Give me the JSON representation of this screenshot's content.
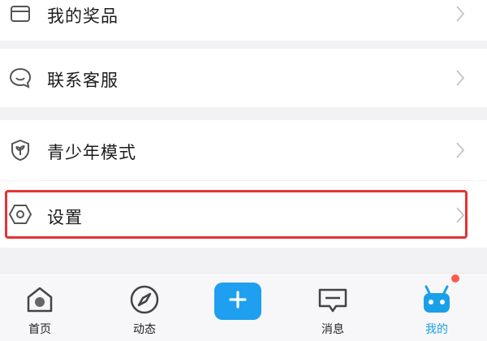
{
  "menu": {
    "items": [
      {
        "label": "我的奖品",
        "icon": "gift-icon"
      },
      {
        "label": "联系客服",
        "icon": "chat-icon"
      },
      {
        "label": "青少年模式",
        "icon": "shield-leaf-icon"
      },
      {
        "label": "设置",
        "icon": "hexagon-settings-icon"
      }
    ]
  },
  "tabbar": {
    "tabs": [
      {
        "label": "首页",
        "icon": "home-icon",
        "active": false
      },
      {
        "label": "动态",
        "icon": "compass-icon",
        "active": false
      },
      {
        "label": "消息",
        "icon": "message-icon",
        "active": false
      },
      {
        "label": "我的",
        "icon": "robot-icon",
        "active": true
      }
    ],
    "add_icon": "plus-icon"
  },
  "colors": {
    "accent": "#1f9ff0",
    "active_tab": "#1aa0e8",
    "highlight": "#e53232",
    "badge": "#ff5a4a"
  }
}
